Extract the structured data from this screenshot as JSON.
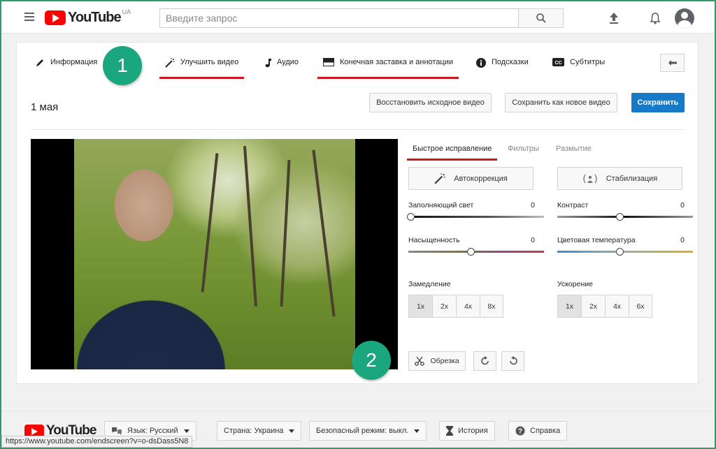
{
  "masthead": {
    "logo_text": "YouTube",
    "country": "UA",
    "search_placeholder": "Введите запрос"
  },
  "tabs": [
    {
      "label": "Информация",
      "icon": "pencil-icon"
    },
    {
      "label": "Улучшить видео",
      "icon": "magic-wand-icon",
      "active": true
    },
    {
      "label": "Аудио",
      "icon": "music-note-icon"
    },
    {
      "label": "Конечная заставка и аннотации",
      "icon": "end-screen-icon",
      "active": true
    },
    {
      "label": "Подсказки",
      "icon": "info-icon"
    },
    {
      "label": "Субтитры",
      "icon": "cc-icon"
    }
  ],
  "video_title": "1 мая",
  "actions": {
    "revert": "Восстановить исходное видео",
    "save_new": "Сохранить как новое видео",
    "save": "Сохранить"
  },
  "subtabs": {
    "quick_fix": "Быстрое исправление",
    "filters": "Фильтры",
    "blur": "Размытие"
  },
  "quick_fix": {
    "autofix": "Автокоррекция",
    "stabilize": "Стабилизация",
    "sliders": [
      {
        "label": "Заполняющий свет",
        "value": "0"
      },
      {
        "label": "Контраст",
        "value": "0"
      },
      {
        "label": "Насыщенность",
        "value": "0"
      },
      {
        "label": "Цветовая температура",
        "value": "0"
      }
    ],
    "slow_motion_label": "Замедление",
    "slow_motion_options": [
      "1x",
      "2x",
      "4x",
      "8x"
    ],
    "timelapse_label": "Ускорение",
    "timelapse_options": [
      "1x",
      "2x",
      "4x",
      "6x"
    ],
    "trim": "Обрезка"
  },
  "callouts": [
    "1",
    "2"
  ],
  "footer": {
    "language": "Язык: Русский",
    "country": "Страна: Украина",
    "safety": "Безопасный режим: выкл.",
    "history": "История",
    "help": "Справка"
  },
  "status_url": "https://www.youtube.com/endscreen?v=o-dsDass5N8",
  "colors": {
    "accent_red": "#cc181e",
    "primary_blue": "#167ac6",
    "callout_green": "#1aa67e"
  }
}
